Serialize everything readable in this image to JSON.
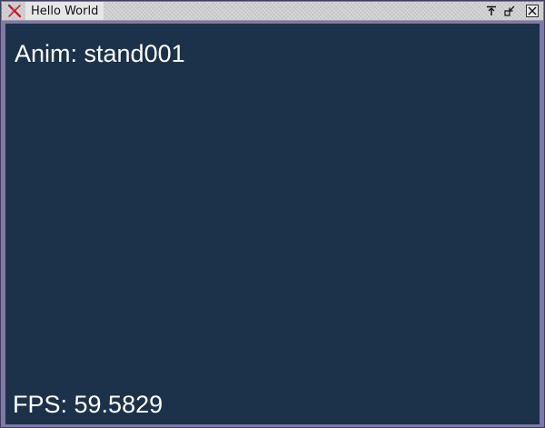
{
  "window": {
    "title": "Hello World",
    "icons": {
      "app": "x-close-app-icon",
      "pin": "pin-on-top-icon",
      "restore": "restore-icon",
      "close": "close-box-icon"
    }
  },
  "viewport": {
    "anim_text": "Anim: stand001",
    "fps_text": "FPS: 59.5829",
    "background_color": "#1c324a",
    "text_color": "#ffffff"
  }
}
